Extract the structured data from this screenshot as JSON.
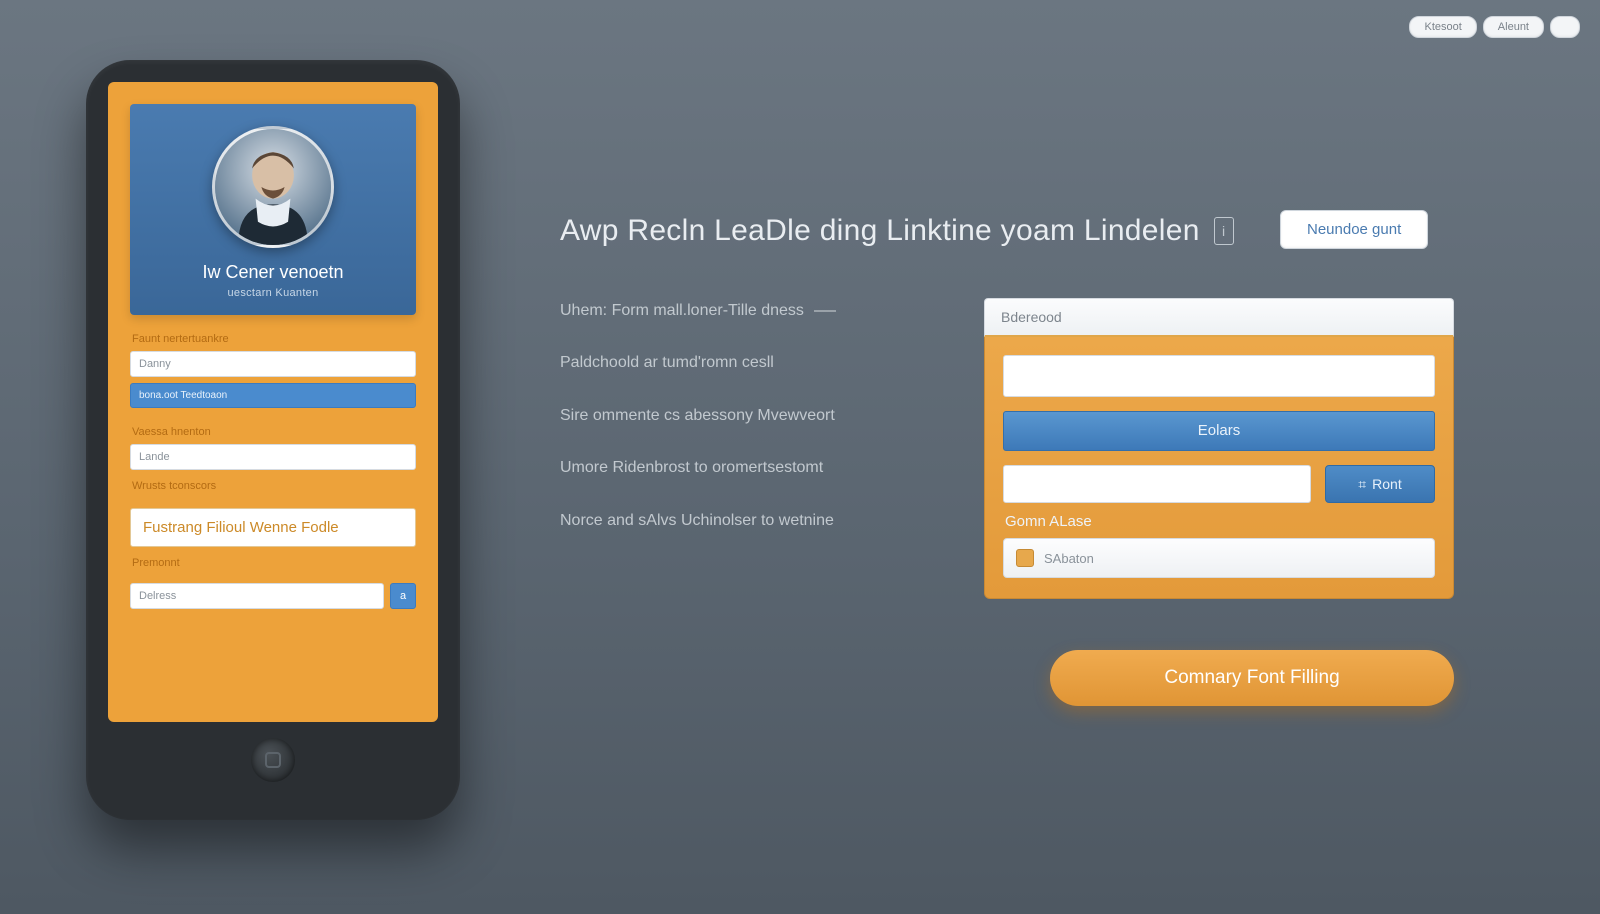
{
  "colors": {
    "accent_orange": "#e9a343",
    "accent_blue": "#3d79b8"
  },
  "top_nav": {
    "item1": "Ktesoot",
    "item2": "Aleunt",
    "item3": ""
  },
  "headline": "Awp Recln LeaDle ding Linktine yoam Lindelen",
  "headline_button": "Neundoe gunt",
  "bullets": {
    "b1": "Uhem: Form mall.loner-Tille dness",
    "b2": "Paldchoold ar tumd'romn cesll",
    "b3": "Sire ommente cs abessony Mvewveort",
    "b4": "Umore Ridenbrost to oromertsestomt",
    "b5": "Norce and sAlvs Uchinolser to wetnine"
  },
  "phone": {
    "profile_name": "Iw Cener venoetn",
    "profile_sub": "uesctarn Kuanten",
    "sec1_label": "Faunt nertertuankre",
    "sec1_field1": "Danny",
    "sec1_field2": "bona.oot Teedtoaon",
    "sec2_label": "Vaessa hnenton",
    "sec2_field1": "Lande",
    "sec3_label": "Wrusts tconscors",
    "sec_title": "Fustrang Filioul Wenne Fodle",
    "last_label": "Premonnt",
    "last_field": "Delress",
    "last_sq": "a"
  },
  "form": {
    "header": "Bdereood",
    "primary_btn": "Eolars",
    "side_btn": "Ront",
    "sublabel": "Gomn ALase",
    "drop_label": "SAbaton"
  },
  "cta_label": "Comnary Font Filling"
}
